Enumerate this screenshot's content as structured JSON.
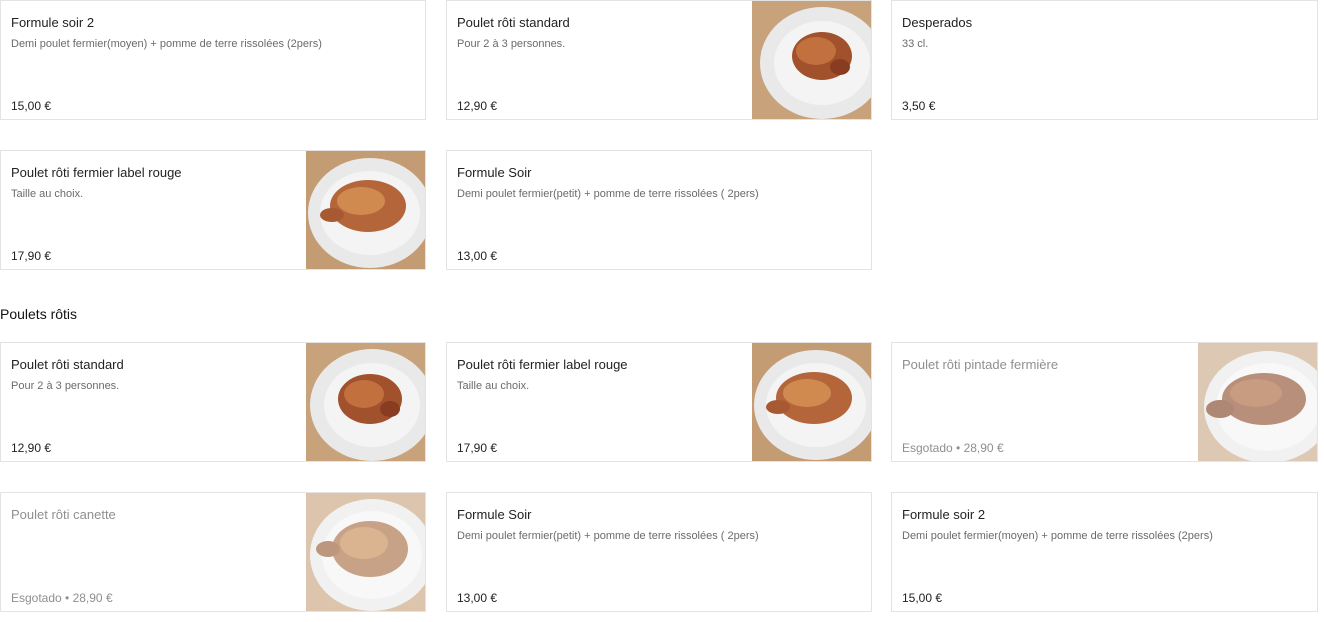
{
  "top_items": [
    {
      "title": "Formule soir 2",
      "description": "Demi poulet fermier(moyen) + pomme de terre rissolées (2pers)",
      "price": "15,00 €"
    },
    {
      "title": "Poulet rôti standard",
      "description": "Pour 2 à 3 personnes.",
      "price": "12,90 €"
    },
    {
      "title": "Desperados",
      "description": "33 cl.",
      "price": "3,50 €"
    },
    {
      "title": "Poulet rôti fermier label rouge",
      "description": "Taille au choix.",
      "price": "17,90 €"
    },
    {
      "title": "Formule Soir",
      "description": "Demi poulet fermier(petit) + pomme de terre rissolées ( 2pers)",
      "price": "13,00 €"
    }
  ],
  "sections": {
    "poulets_rotis": {
      "heading": "Poulets rôtis",
      "items": [
        {
          "title": "Poulet rôti standard",
          "description": "Pour 2 à 3 personnes.",
          "price": "12,90 €"
        },
        {
          "title": "Poulet rôti fermier label rouge",
          "description": "Taille au choix.",
          "price": "17,90 €"
        },
        {
          "title": "Poulet rôti pintade fermière",
          "price": "Esgotado • 28,90 €"
        },
        {
          "title": "Poulet rôti canette",
          "price": "Esgotado • 28,90 €"
        },
        {
          "title": "Formule Soir",
          "description": "Demi poulet fermier(petit) + pomme de terre rissolées ( 2pers)",
          "price": "13,00 €"
        },
        {
          "title": "Formule soir 2",
          "description": "Demi poulet fermier(moyen) + pomme de terre rissolées (2pers)",
          "price": "15,00 €"
        }
      ]
    }
  },
  "icons": {
    "thumbnail": "roast-chicken-photo"
  },
  "colors": {
    "border": "#e3e3e3",
    "text": "#222222",
    "muted": "#6b6b6b",
    "unavailable": "#8f8f8f"
  }
}
